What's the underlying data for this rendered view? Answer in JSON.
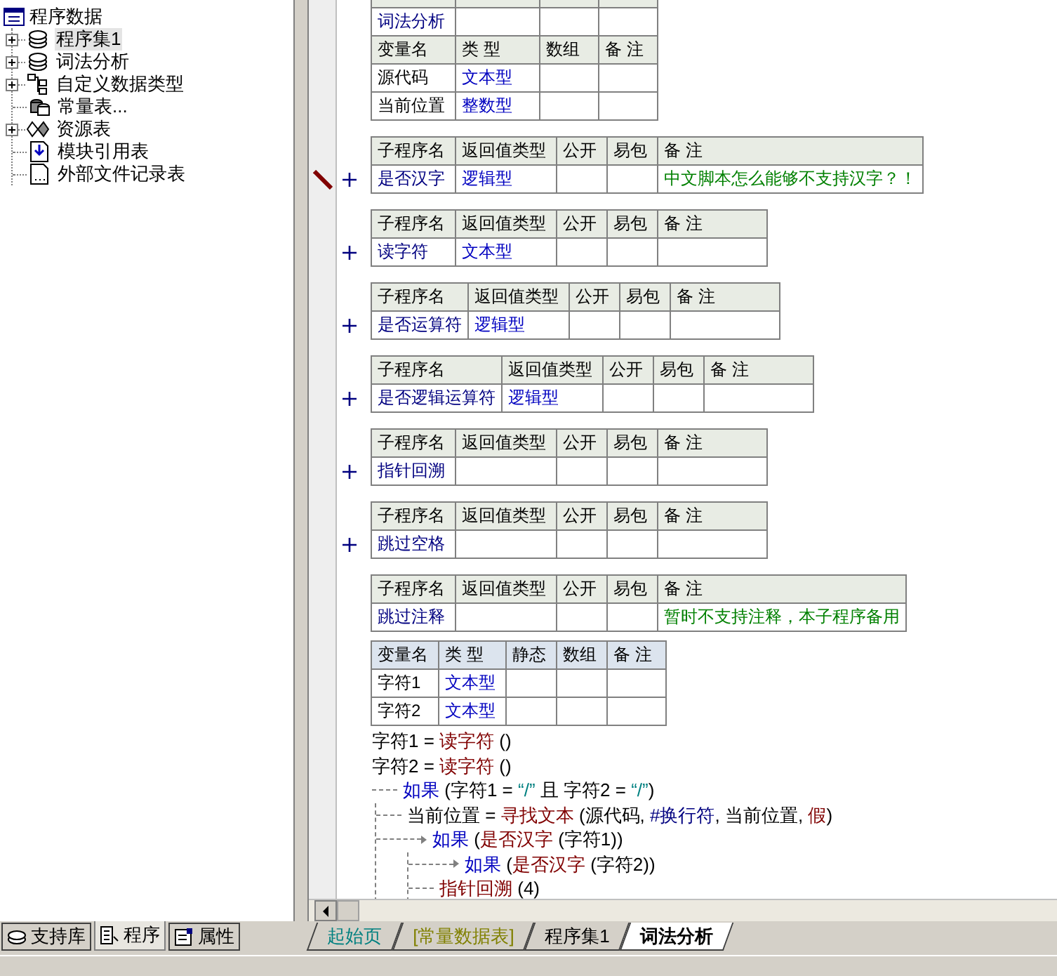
{
  "tree": {
    "root": "程序数据",
    "items": [
      {
        "label": "程序集1",
        "kind": "assembly",
        "expandable": true,
        "selected": true
      },
      {
        "label": "词法分析",
        "kind": "assembly",
        "expandable": true,
        "selected": false
      },
      {
        "label": "自定义数据类型",
        "kind": "datatype",
        "expandable": true,
        "selected": false
      },
      {
        "label": "常量表...",
        "kind": "constants",
        "expandable": false,
        "selected": false
      },
      {
        "label": "资源表",
        "kind": "resources",
        "expandable": true,
        "selected": false
      },
      {
        "label": "模块引用表",
        "kind": "module",
        "expandable": false,
        "selected": false
      },
      {
        "label": "外部文件记录表",
        "kind": "file",
        "expandable": false,
        "selected": false
      }
    ]
  },
  "assembly": {
    "name": "词法分析",
    "var_columns": [
      "变量名",
      "类 型",
      "数组",
      "备 注"
    ],
    "vars": [
      {
        "name": "源代码",
        "type": "文本型"
      },
      {
        "name": "当前位置",
        "type": "整数型"
      }
    ]
  },
  "subroutines": [
    {
      "columns": [
        "子程序名",
        "返回值类型",
        "公开",
        "易包",
        "备 注"
      ],
      "name": "是否汉字",
      "return_type": "逻辑型",
      "note": "中文脚本怎么能够不支持汉字？！",
      "editing": true,
      "expanded": false
    },
    {
      "columns": [
        "子程序名",
        "返回值类型",
        "公开",
        "易包",
        "备 注"
      ],
      "name": "读字符",
      "return_type": "文本型",
      "editing": false,
      "expanded": false
    },
    {
      "columns": [
        "子程序名",
        "返回值类型",
        "公开",
        "易包",
        "备 注"
      ],
      "name": "是否运算符",
      "return_type": "逻辑型",
      "editing": false,
      "expanded": false
    },
    {
      "columns": [
        "子程序名",
        "返回值类型",
        "公开",
        "易包",
        "备 注"
      ],
      "name": "是否逻辑运算符",
      "return_type": "逻辑型",
      "editing": false,
      "expanded": false
    },
    {
      "columns": [
        "子程序名",
        "返回值类型",
        "公开",
        "易包",
        "备 注"
      ],
      "name": "指针回溯",
      "editing": false,
      "expanded": false
    },
    {
      "columns": [
        "子程序名",
        "返回值类型",
        "公开",
        "易包",
        "备 注"
      ],
      "name": "跳过空格",
      "editing": false,
      "expanded": false
    },
    {
      "columns": [
        "子程序名",
        "返回值类型",
        "公开",
        "易包",
        "备 注"
      ],
      "name": "跳过注释",
      "note": "暂时不支持注释，本子程序备用",
      "editing": false,
      "expanded": true,
      "local_columns": [
        "变量名",
        "类 型",
        "静态",
        "数组",
        "备 注"
      ],
      "locals": [
        {
          "name": "字符1",
          "type": "文本型"
        },
        {
          "name": "字符2",
          "type": "文本型"
        }
      ],
      "code": [
        {
          "tokens": [
            {
              "t": "字符1",
              "kind": "var"
            },
            {
              "t": " = ",
              "kind": "op"
            },
            {
              "t": "读字符",
              "kind": "func"
            },
            {
              "t": " ()",
              "kind": "op"
            }
          ]
        },
        {
          "tokens": [
            {
              "t": "字符2",
              "kind": "var"
            },
            {
              "t": " = ",
              "kind": "op"
            },
            {
              "t": "读字符",
              "kind": "func"
            },
            {
              "t": " ()",
              "kind": "op"
            }
          ]
        },
        {
          "kind": "branch",
          "tokens": [
            {
              "t": "如果",
              "kind": "keyword"
            },
            {
              "t": " (字符1 = ",
              "kind": "op"
            },
            {
              "t": "“/”",
              "kind": "string"
            },
            {
              "t": " 且 字符2 = ",
              "kind": "op"
            },
            {
              "t": "“/”",
              "kind": "string"
            },
            {
              "t": ")",
              "kind": "op"
            }
          ],
          "children": [
            {
              "tokens": [
                {
                  "t": "当前位置",
                  "kind": "var"
                },
                {
                  "t": " = ",
                  "kind": "op"
                },
                {
                  "t": "寻找文本",
                  "kind": "func"
                },
                {
                  "t": " (源代码, ",
                  "kind": "op"
                },
                {
                  "t": "#换行符",
                  "kind": "const"
                },
                {
                  "t": ", 当前位置, ",
                  "kind": "op"
                },
                {
                  "t": "假",
                  "kind": "func"
                },
                {
                  "t": ")",
                  "kind": "op"
                }
              ]
            },
            {
              "kind": "branch",
              "tokens": [
                {
                  "t": "如果",
                  "kind": "keyword"
                },
                {
                  "t": " (",
                  "kind": "op"
                },
                {
                  "t": "是否汉字",
                  "kind": "func"
                },
                {
                  "t": " (字符1))",
                  "kind": "op"
                }
              ],
              "children": [
                {
                  "kind": "branch",
                  "tokens": [
                    {
                      "t": "如果",
                      "kind": "keyword"
                    },
                    {
                      "t": " (",
                      "kind": "op"
                    },
                    {
                      "t": "是否汉字",
                      "kind": "func"
                    },
                    {
                      "t": " (字符2))",
                      "kind": "op"
                    }
                  ]
                },
                {
                  "tokens": [
                    {
                      "t": "指针回溯",
                      "kind": "func"
                    },
                    {
                      "t": " (4)",
                      "kind": "op"
                    }
                  ]
                }
              ]
            }
          ]
        }
      ]
    }
  ],
  "panel_tabs": [
    {
      "label": "支持库",
      "kind": "books",
      "selected": false
    },
    {
      "label": "程序",
      "kind": "code",
      "selected": true
    },
    {
      "label": "属性",
      "kind": "props",
      "selected": false
    }
  ],
  "doc_tabs": [
    {
      "label": "起始页",
      "color": "#008080",
      "selected": false
    },
    {
      "label": "[常量数据表]",
      "color": "#808000",
      "selected": false
    },
    {
      "label": "程序集1",
      "color": "#000000",
      "selected": false
    },
    {
      "label": "词法分析",
      "color": "#000000",
      "selected": true
    }
  ]
}
